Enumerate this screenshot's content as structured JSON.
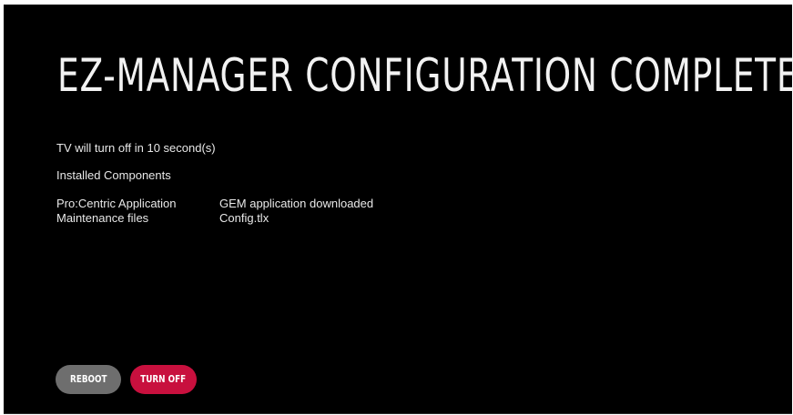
{
  "title": "EZ-MANAGER CONFIGURATION COMPLETE",
  "countdown_text": "TV will turn off in 10 second(s)",
  "installed_heading": "Installed Components",
  "components": [
    {
      "name": "Pro:Centric Application",
      "value": "GEM application downloaded"
    },
    {
      "name": "Maintenance files",
      "value": "Config.tlx"
    }
  ],
  "buttons": {
    "reboot_label": "REBOOT",
    "turn_off_label": "TURN OFF"
  },
  "colors": {
    "background": "#000000",
    "reboot_button": "#6e6e6e",
    "turn_off_button": "#c8103e",
    "text": "#ffffff"
  }
}
